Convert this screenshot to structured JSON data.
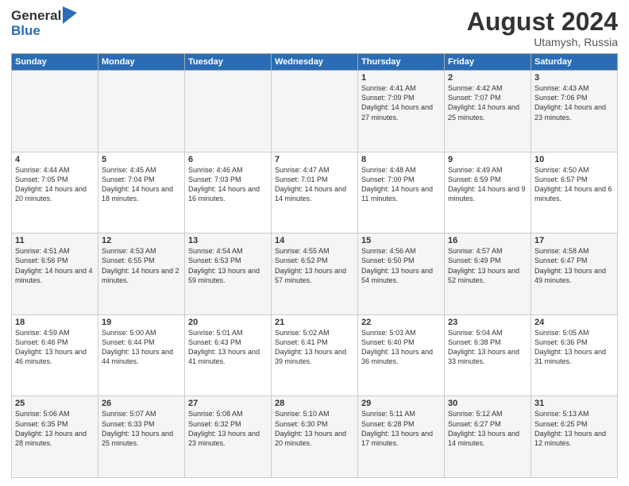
{
  "header": {
    "logo_general": "General",
    "logo_blue": "Blue",
    "month_year": "August 2024",
    "location": "Utamysh, Russia"
  },
  "weekdays": [
    "Sunday",
    "Monday",
    "Tuesday",
    "Wednesday",
    "Thursday",
    "Friday",
    "Saturday"
  ],
  "weeks": [
    [
      {
        "day": "",
        "info": ""
      },
      {
        "day": "",
        "info": ""
      },
      {
        "day": "",
        "info": ""
      },
      {
        "day": "",
        "info": ""
      },
      {
        "day": "1",
        "info": "Sunrise: 4:41 AM\nSunset: 7:09 PM\nDaylight: 14 hours\nand 27 minutes."
      },
      {
        "day": "2",
        "info": "Sunrise: 4:42 AM\nSunset: 7:07 PM\nDaylight: 14 hours\nand 25 minutes."
      },
      {
        "day": "3",
        "info": "Sunrise: 4:43 AM\nSunset: 7:06 PM\nDaylight: 14 hours\nand 23 minutes."
      }
    ],
    [
      {
        "day": "4",
        "info": "Sunrise: 4:44 AM\nSunset: 7:05 PM\nDaylight: 14 hours\nand 20 minutes."
      },
      {
        "day": "5",
        "info": "Sunrise: 4:45 AM\nSunset: 7:04 PM\nDaylight: 14 hours\nand 18 minutes."
      },
      {
        "day": "6",
        "info": "Sunrise: 4:46 AM\nSunset: 7:03 PM\nDaylight: 14 hours\nand 16 minutes."
      },
      {
        "day": "7",
        "info": "Sunrise: 4:47 AM\nSunset: 7:01 PM\nDaylight: 14 hours\nand 14 minutes."
      },
      {
        "day": "8",
        "info": "Sunrise: 4:48 AM\nSunset: 7:00 PM\nDaylight: 14 hours\nand 11 minutes."
      },
      {
        "day": "9",
        "info": "Sunrise: 4:49 AM\nSunset: 6:59 PM\nDaylight: 14 hours\nand 9 minutes."
      },
      {
        "day": "10",
        "info": "Sunrise: 4:50 AM\nSunset: 6:57 PM\nDaylight: 14 hours\nand 6 minutes."
      }
    ],
    [
      {
        "day": "11",
        "info": "Sunrise: 4:51 AM\nSunset: 6:56 PM\nDaylight: 14 hours\nand 4 minutes."
      },
      {
        "day": "12",
        "info": "Sunrise: 4:53 AM\nSunset: 6:55 PM\nDaylight: 14 hours\nand 2 minutes."
      },
      {
        "day": "13",
        "info": "Sunrise: 4:54 AM\nSunset: 6:53 PM\nDaylight: 13 hours\nand 59 minutes."
      },
      {
        "day": "14",
        "info": "Sunrise: 4:55 AM\nSunset: 6:52 PM\nDaylight: 13 hours\nand 57 minutes."
      },
      {
        "day": "15",
        "info": "Sunrise: 4:56 AM\nSunset: 6:50 PM\nDaylight: 13 hours\nand 54 minutes."
      },
      {
        "day": "16",
        "info": "Sunrise: 4:57 AM\nSunset: 6:49 PM\nDaylight: 13 hours\nand 52 minutes."
      },
      {
        "day": "17",
        "info": "Sunrise: 4:58 AM\nSunset: 6:47 PM\nDaylight: 13 hours\nand 49 minutes."
      }
    ],
    [
      {
        "day": "18",
        "info": "Sunrise: 4:59 AM\nSunset: 6:46 PM\nDaylight: 13 hours\nand 46 minutes."
      },
      {
        "day": "19",
        "info": "Sunrise: 5:00 AM\nSunset: 6:44 PM\nDaylight: 13 hours\nand 44 minutes."
      },
      {
        "day": "20",
        "info": "Sunrise: 5:01 AM\nSunset: 6:43 PM\nDaylight: 13 hours\nand 41 minutes."
      },
      {
        "day": "21",
        "info": "Sunrise: 5:02 AM\nSunset: 6:41 PM\nDaylight: 13 hours\nand 39 minutes."
      },
      {
        "day": "22",
        "info": "Sunrise: 5:03 AM\nSunset: 6:40 PM\nDaylight: 13 hours\nand 36 minutes."
      },
      {
        "day": "23",
        "info": "Sunrise: 5:04 AM\nSunset: 6:38 PM\nDaylight: 13 hours\nand 33 minutes."
      },
      {
        "day": "24",
        "info": "Sunrise: 5:05 AM\nSunset: 6:36 PM\nDaylight: 13 hours\nand 31 minutes."
      }
    ],
    [
      {
        "day": "25",
        "info": "Sunrise: 5:06 AM\nSunset: 6:35 PM\nDaylight: 13 hours\nand 28 minutes."
      },
      {
        "day": "26",
        "info": "Sunrise: 5:07 AM\nSunset: 6:33 PM\nDaylight: 13 hours\nand 25 minutes."
      },
      {
        "day": "27",
        "info": "Sunrise: 5:08 AM\nSunset: 6:32 PM\nDaylight: 13 hours\nand 23 minutes."
      },
      {
        "day": "28",
        "info": "Sunrise: 5:10 AM\nSunset: 6:30 PM\nDaylight: 13 hours\nand 20 minutes."
      },
      {
        "day": "29",
        "info": "Sunrise: 5:11 AM\nSunset: 6:28 PM\nDaylight: 13 hours\nand 17 minutes."
      },
      {
        "day": "30",
        "info": "Sunrise: 5:12 AM\nSunset: 6:27 PM\nDaylight: 13 hours\nand 14 minutes."
      },
      {
        "day": "31",
        "info": "Sunrise: 5:13 AM\nSunset: 6:25 PM\nDaylight: 13 hours\nand 12 minutes."
      }
    ]
  ]
}
